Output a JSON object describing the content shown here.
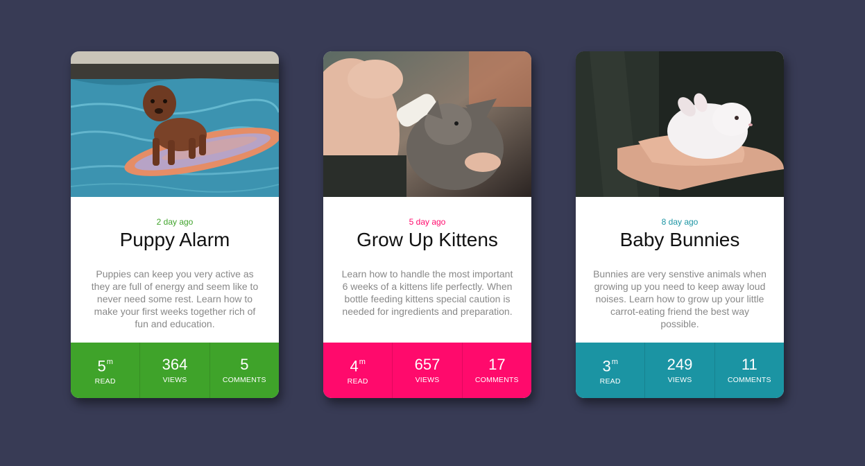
{
  "colors": {
    "background": "#383b55",
    "green": "#3fa32a",
    "pink": "#ff0a6c",
    "teal": "#1b94a3"
  },
  "cards": [
    {
      "image_icon": "puppy-on-surfboard-photo",
      "date": "2 day ago",
      "title": "Puppy Alarm",
      "description": "Puppies can keep you very active as they are full of energy and seem like to never need some rest. Learn how to make your first weeks together rich of fun and education.",
      "accent": "#3fa32a",
      "stats": [
        {
          "value": "5",
          "unit": "m",
          "label": "READ"
        },
        {
          "value": "364",
          "unit": "",
          "label": "VIEWS"
        },
        {
          "value": "5",
          "unit": "",
          "label": "COMMENTS"
        }
      ]
    },
    {
      "image_icon": "kitten-bottle-feeding-photo",
      "date": "5 day ago",
      "title": "Grow Up Kittens",
      "description": "Learn how to handle the most important 6 weeks of a kittens life perfectly. When bottle feeding kittens special caution is needed for ingredients and preparation.",
      "accent": "#ff0a6c",
      "stats": [
        {
          "value": "4",
          "unit": "m",
          "label": "READ"
        },
        {
          "value": "657",
          "unit": "",
          "label": "VIEWS"
        },
        {
          "value": "17",
          "unit": "",
          "label": "COMMENTS"
        }
      ]
    },
    {
      "image_icon": "bunny-in-hands-photo",
      "date": "8 day ago",
      "title": "Baby Bunnies",
      "description": "Bunnies are very senstive animals when growing up you need to keep away loud noises. Learn how to grow up your little carrot-eating friend the best way possible.",
      "accent": "#1b94a3",
      "stats": [
        {
          "value": "3",
          "unit": "m",
          "label": "READ"
        },
        {
          "value": "249",
          "unit": "",
          "label": "VIEWS"
        },
        {
          "value": "11",
          "unit": "",
          "label": "COMMENTS"
        }
      ]
    }
  ]
}
